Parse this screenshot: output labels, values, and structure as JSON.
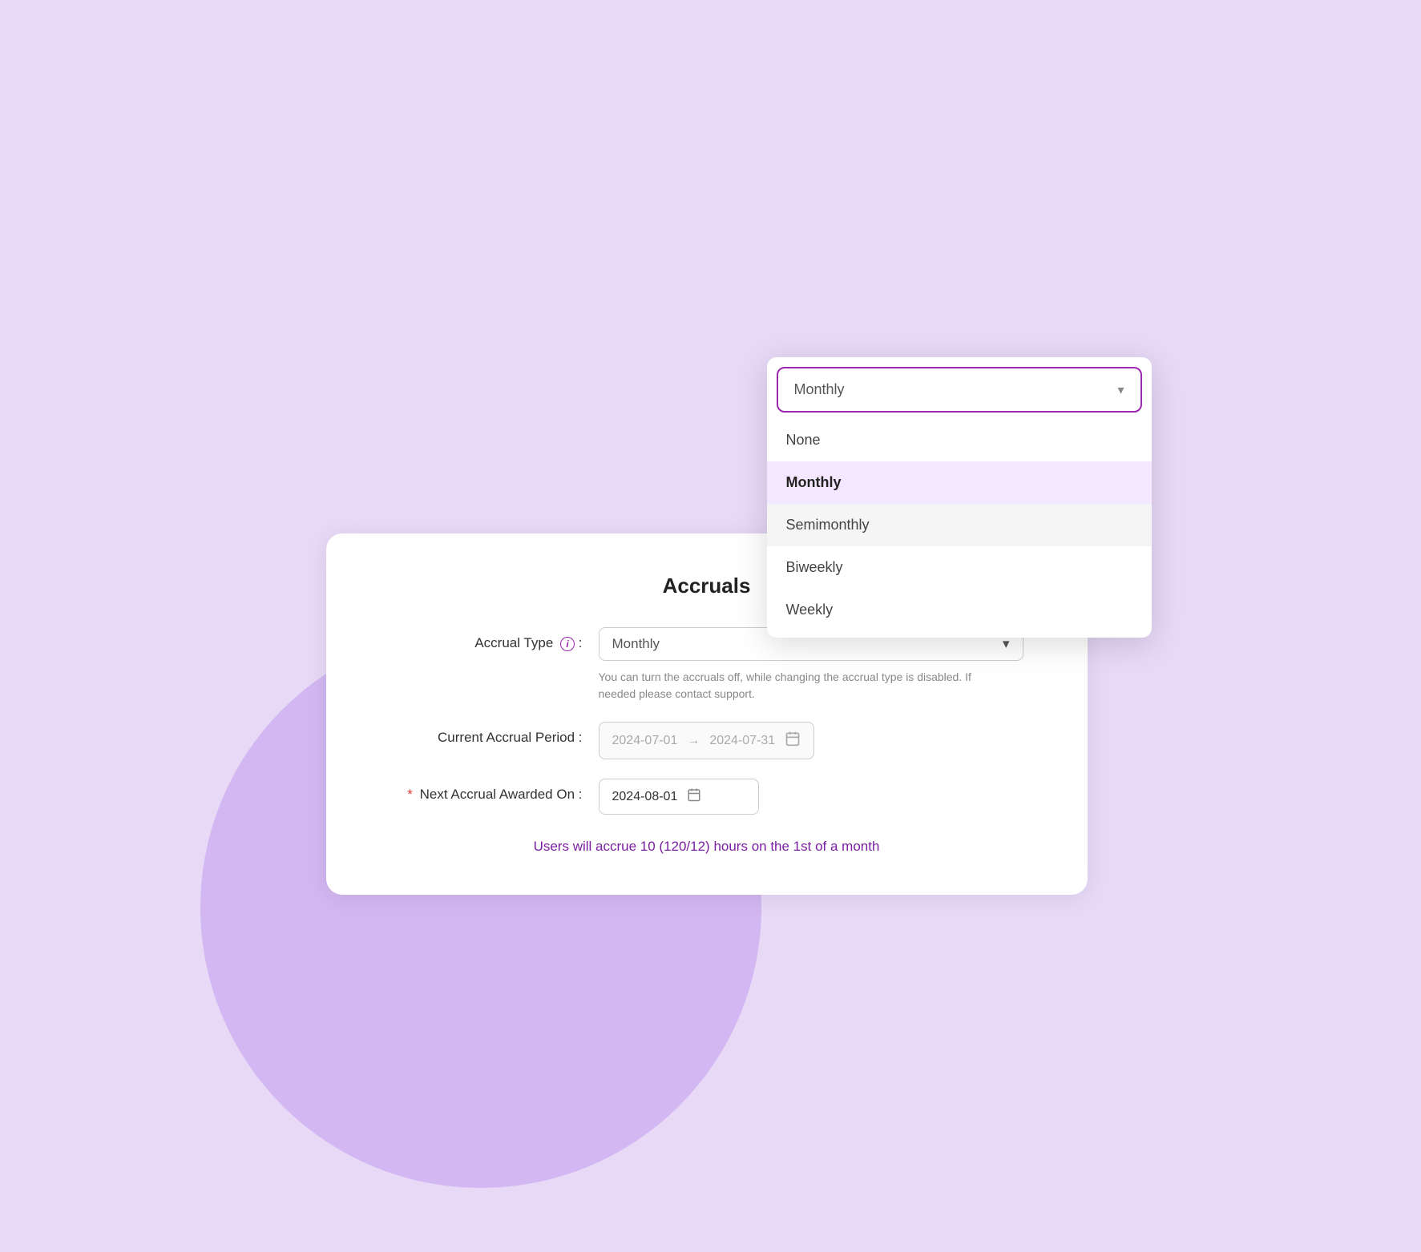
{
  "background": {
    "color": "#e8d9f7"
  },
  "dropdown": {
    "trigger_value": "Monthly",
    "chevron": "▼",
    "options": [
      {
        "label": "None",
        "selected": false,
        "hovered": false
      },
      {
        "label": "Monthly",
        "selected": true,
        "hovered": false
      },
      {
        "label": "Semimonthly",
        "selected": false,
        "hovered": true
      },
      {
        "label": "Biweekly",
        "selected": false,
        "hovered": false
      },
      {
        "label": "Weekly",
        "selected": false,
        "hovered": false
      }
    ]
  },
  "card": {
    "title": "Accruals",
    "accrual_type_label": "Accrual Type",
    "accrual_type_value": "Monthly",
    "hint_text": "You can turn the accruals off, while changing the accrual type is disabled. If needed please contact support.",
    "current_period_label": "Current Accrual Period :",
    "period_start": "2024-07-01",
    "period_arrow": "→",
    "period_end": "2024-07-31",
    "next_accrual_label": "Next Accrual Awarded On :",
    "next_accrual_date": "2024-08-01",
    "summary_text": "Users will accrue 10 (120/12) hours on the 1st of a month"
  },
  "icons": {
    "chevron_down": "⌄",
    "calendar": "📅",
    "info": "i"
  }
}
